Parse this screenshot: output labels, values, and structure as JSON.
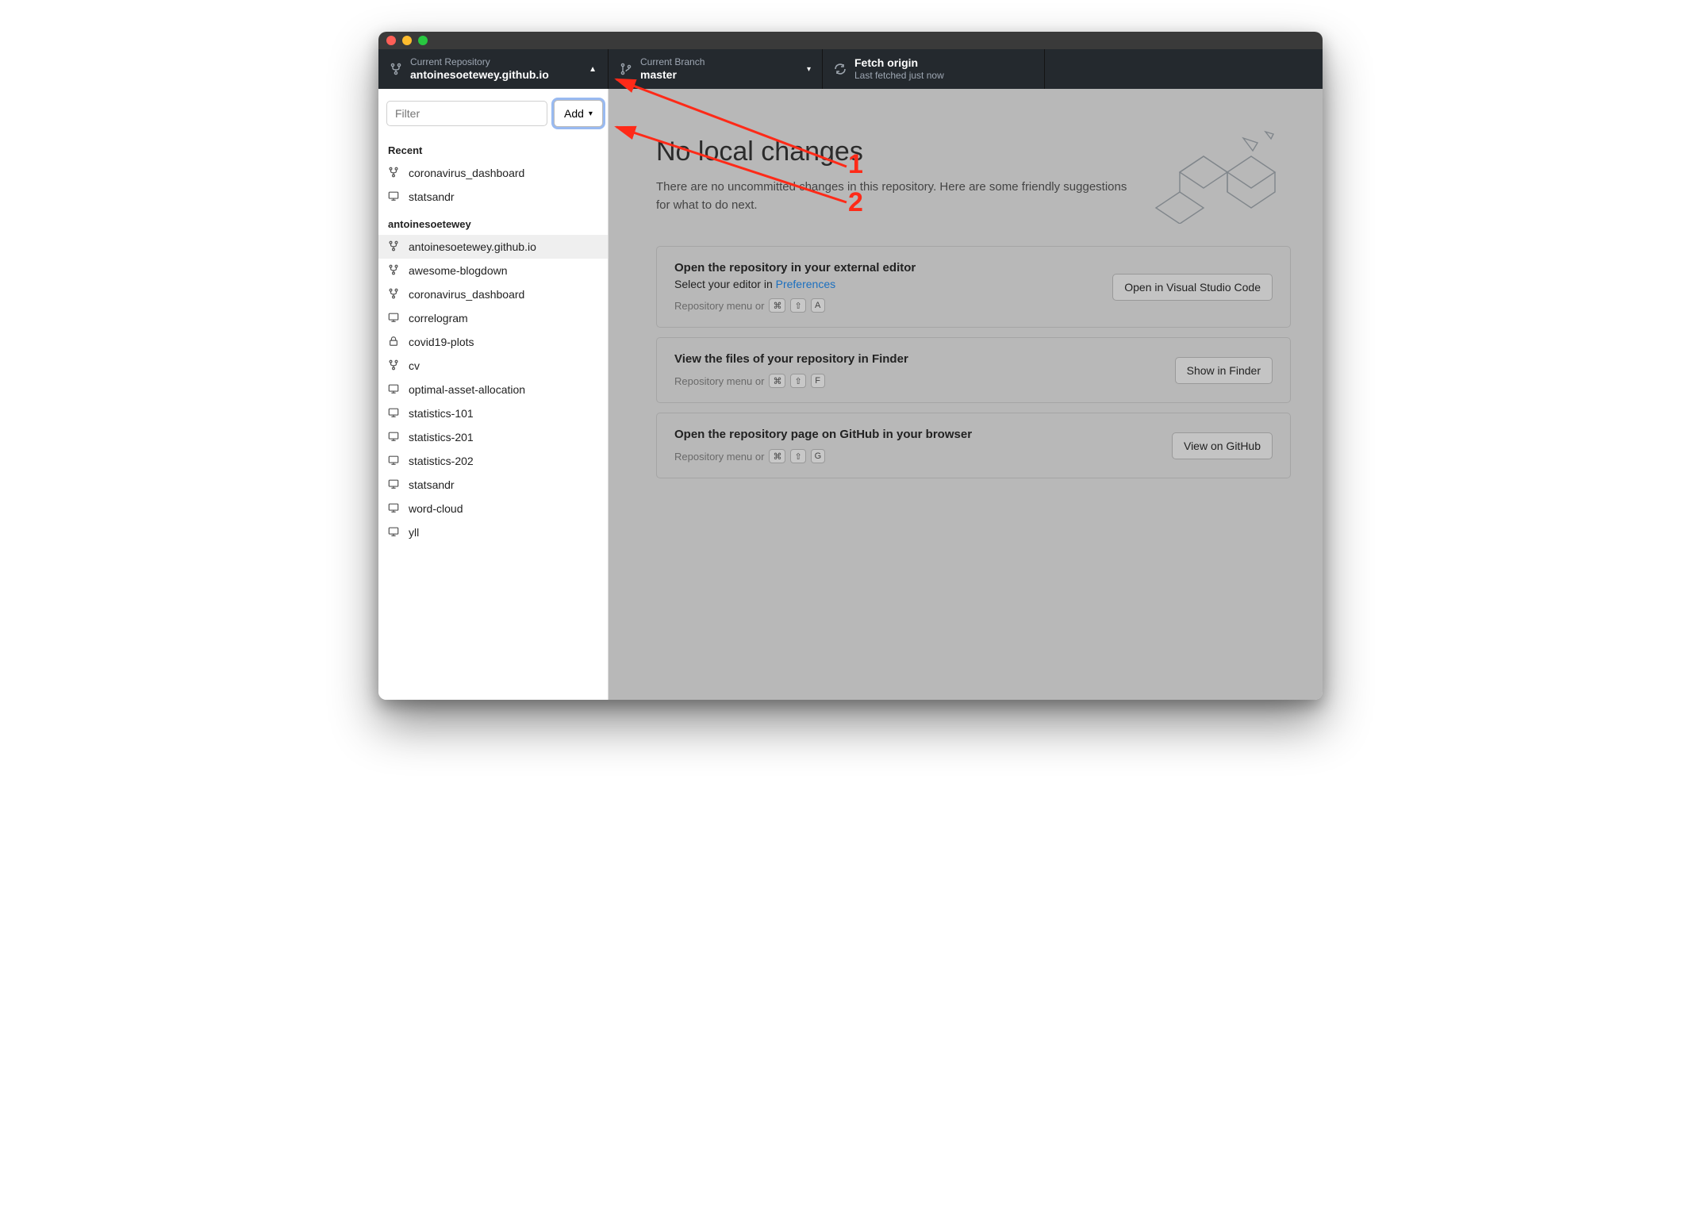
{
  "toolbar": {
    "repo": {
      "label": "Current Repository",
      "value": "antoinesoetewey.github.io"
    },
    "branch": {
      "label": "Current Branch",
      "value": "master"
    },
    "fetch": {
      "label": "Fetch origin",
      "sub": "Last fetched just now"
    }
  },
  "sidebar": {
    "filter_placeholder": "Filter",
    "add_label": "Add",
    "recent_title": "Recent",
    "recent": [
      {
        "name": "coronavirus_dashboard",
        "icon": "fork"
      },
      {
        "name": "statsandr",
        "icon": "monitor"
      }
    ],
    "owner_title": "antoinesoetewey",
    "repos": [
      {
        "name": "antoinesoetewey.github.io",
        "icon": "fork",
        "selected": true
      },
      {
        "name": "awesome-blogdown",
        "icon": "fork"
      },
      {
        "name": "coronavirus_dashboard",
        "icon": "fork"
      },
      {
        "name": "correlogram",
        "icon": "monitor"
      },
      {
        "name": "covid19-plots",
        "icon": "lock"
      },
      {
        "name": "cv",
        "icon": "fork"
      },
      {
        "name": "optimal-asset-allocation",
        "icon": "monitor"
      },
      {
        "name": "statistics-101",
        "icon": "monitor"
      },
      {
        "name": "statistics-201",
        "icon": "monitor"
      },
      {
        "name": "statistics-202",
        "icon": "monitor"
      },
      {
        "name": "statsandr",
        "icon": "monitor"
      },
      {
        "name": "word-cloud",
        "icon": "monitor"
      },
      {
        "name": "yll",
        "icon": "monitor"
      }
    ]
  },
  "main": {
    "headline": "No local changes",
    "sub_prefix": "There are no uncommitted changes in this repository. Here are some friendly suggestions for what to do next.",
    "cards": [
      {
        "title": "Open the repository in your external editor",
        "sub_before": "Select your editor in ",
        "sub_link": "Preferences",
        "hint_prefix": "Repository menu or",
        "keys": [
          "⌘",
          "⇧",
          "A"
        ],
        "button": "Open in Visual Studio Code"
      },
      {
        "title": "View the files of your repository in Finder",
        "hint_prefix": "Repository menu or",
        "keys": [
          "⌘",
          "⇧",
          "F"
        ],
        "button": "Show in Finder"
      },
      {
        "title": "Open the repository page on GitHub in your browser",
        "hint_prefix": "Repository menu or",
        "keys": [
          "⌘",
          "⇧",
          "G"
        ],
        "button": "View on GitHub"
      }
    ]
  },
  "annotations": {
    "n1": "1",
    "n2": "2"
  }
}
